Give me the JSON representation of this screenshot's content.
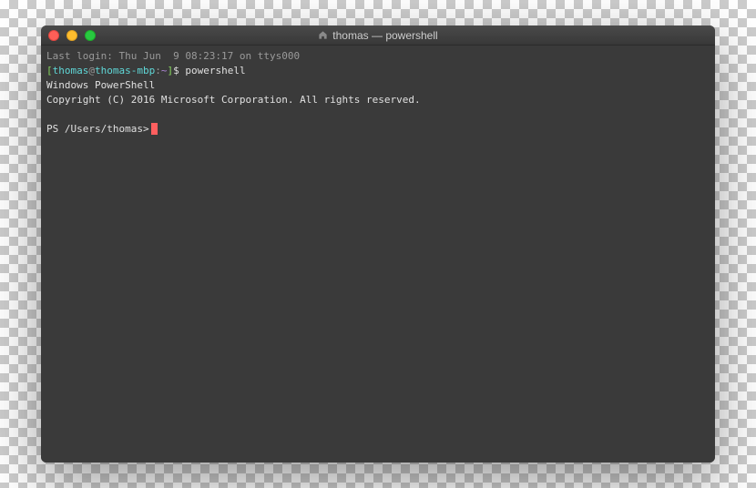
{
  "titlebar": {
    "title": "thomas — powershell"
  },
  "terminal": {
    "last_login": "Last login: Thu Jun  9 08:23:17 on ttys000",
    "prompt_bracket_open": "[",
    "prompt_user": "thomas",
    "prompt_at": "@",
    "prompt_host": "thomas-mbp",
    "prompt_colon": ":",
    "prompt_path": "~",
    "prompt_bracket_close": "]",
    "prompt_symbol": "$ ",
    "command": "powershell",
    "ps_header1": "Windows PowerShell",
    "ps_header2": "Copyright (C) 2016 Microsoft Corporation. All rights reserved.",
    "ps_prompt": "PS /Users/thomas>"
  }
}
